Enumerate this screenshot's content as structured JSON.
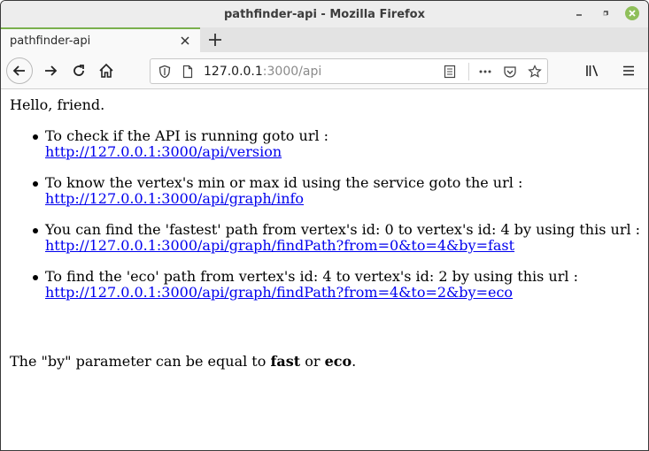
{
  "window": {
    "title": "pathfinder-api - Mozilla Firefox"
  },
  "tab": {
    "label": "pathfinder-api"
  },
  "urlbar": {
    "host": "127.0.0.1",
    "rest": ":3000/api"
  },
  "page": {
    "greeting": "Hello, friend.",
    "items": [
      {
        "text": "To check if the API is running goto url :",
        "link": "http://127.0.0.1:3000/api/version"
      },
      {
        "text": "To know the vertex's min or max id using the service goto the url :",
        "link": "http://127.0.0.1:3000/api/graph/info"
      },
      {
        "text": "You can find the 'fastest' path from vertex's id: 0 to vertex's id: 4 by using this url :",
        "link": "http://127.0.0.1:3000/api/graph/findPath?from=0&to=4&by=fast"
      },
      {
        "text": "To find the 'eco' path from vertex's id: 4 to vertex's id: 2 by using this url :",
        "link": "http://127.0.0.1:3000/api/graph/findPath?from=4&to=2&by=eco"
      }
    ],
    "by_note": {
      "prefix": "The \"by\" parameter can be equal to ",
      "fast": "fast",
      "middle": " or ",
      "eco": "eco",
      "suffix": "."
    }
  },
  "icons": {
    "back": "back-arrow-icon",
    "forward": "forward-arrow-icon",
    "reload": "reload-icon",
    "home": "home-icon",
    "shield": "shield-icon",
    "page": "page-icon",
    "reader": "reader-view-icon",
    "more": "more-icon",
    "pocket": "pocket-icon",
    "star": "star-icon",
    "library": "library-icon",
    "menu": "menu-icon",
    "minimize": "minimize-icon",
    "restore": "restore-icon",
    "close": "close-icon"
  },
  "colors": {
    "link": "#0000ee",
    "tab_accent": "#7ab04d",
    "close_button": "#8fbf5a"
  }
}
